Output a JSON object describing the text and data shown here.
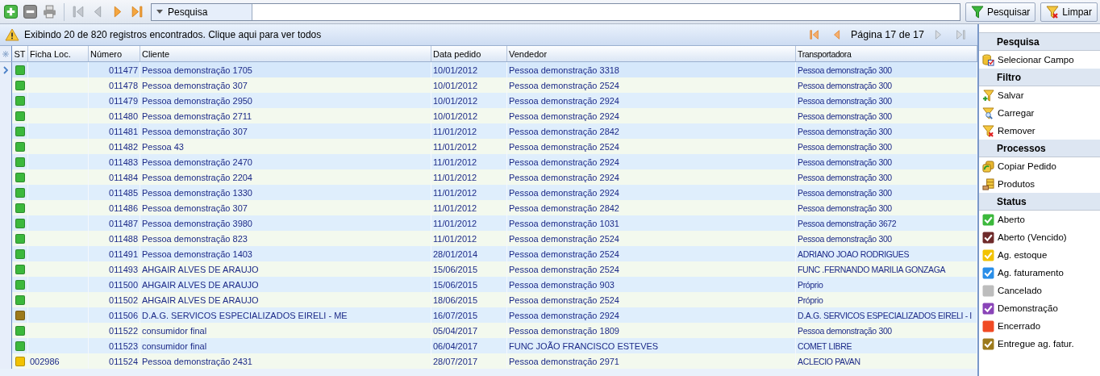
{
  "toolbar": {
    "nav": [
      {
        "kind": "first",
        "disabled": true
      },
      {
        "kind": "prev",
        "disabled": true
      },
      {
        "kind": "next",
        "disabled": false
      },
      {
        "kind": "last",
        "disabled": false
      }
    ],
    "search": {
      "field_selector": "Pesquisa"
    },
    "buttons": [
      {
        "kind": "search",
        "label": "Pesquisar"
      },
      {
        "kind": "clear",
        "label": "Limpar"
      }
    ]
  },
  "info_bar": {
    "message": "Exibindo 20 de 820 registros encontrados. Clique aqui para ver todos",
    "page_label": "Página 17 de 17",
    "nav": [
      {
        "kind": "first",
        "disabled": false
      },
      {
        "kind": "prev",
        "disabled": false
      },
      {
        "kind": "next",
        "disabled": true
      },
      {
        "kind": "last",
        "disabled": true
      }
    ]
  },
  "table": {
    "columns": [
      "ST",
      "Ficha Loc.",
      "Número",
      "Cliente",
      "Data pedido",
      "Vendedor",
      "Transportadora"
    ],
    "rows": [
      {
        "selected": true,
        "color": "#3cb83c",
        "ficha": "",
        "numero": "011477",
        "cliente": "Pessoa demonstração 1705",
        "data": "10/01/2012",
        "vendedor": "Pessoa demonstração 3318",
        "transportadora": "Pessoa demonstração 300"
      },
      {
        "selected": false,
        "color": "#3cb83c",
        "ficha": "",
        "numero": "011478",
        "cliente": "Pessoa demonstração 307",
        "data": "10/01/2012",
        "vendedor": "Pessoa demonstração 2524",
        "transportadora": "Pessoa demonstração 300"
      },
      {
        "selected": false,
        "color": "#3cb83c",
        "ficha": "",
        "numero": "011479",
        "cliente": "Pessoa demonstração 2950",
        "data": "10/01/2012",
        "vendedor": "Pessoa demonstração 2924",
        "transportadora": "Pessoa demonstração 300"
      },
      {
        "selected": false,
        "color": "#3cb83c",
        "ficha": "",
        "numero": "011480",
        "cliente": "Pessoa demonstração 2711",
        "data": "10/01/2012",
        "vendedor": "Pessoa demonstração 2924",
        "transportadora": "Pessoa demonstração 300"
      },
      {
        "selected": false,
        "color": "#3cb83c",
        "ficha": "",
        "numero": "011481",
        "cliente": "Pessoa demonstração 307",
        "data": "11/01/2012",
        "vendedor": "Pessoa demonstração 2842",
        "transportadora": "Pessoa demonstração 300"
      },
      {
        "selected": false,
        "color": "#3cb83c",
        "ficha": "",
        "numero": "011482",
        "cliente": "Pessoa 43",
        "data": "11/01/2012",
        "vendedor": "Pessoa demonstração 2524",
        "transportadora": "Pessoa demonstração 300"
      },
      {
        "selected": false,
        "color": "#3cb83c",
        "ficha": "",
        "numero": "011483",
        "cliente": "Pessoa demonstração 2470",
        "data": "11/01/2012",
        "vendedor": "Pessoa demonstração 2924",
        "transportadora": "Pessoa demonstração 300"
      },
      {
        "selected": false,
        "color": "#3cb83c",
        "ficha": "",
        "numero": "011484",
        "cliente": "Pessoa demonstração 2204",
        "data": "11/01/2012",
        "vendedor": "Pessoa demonstração 2924",
        "transportadora": "Pessoa demonstração 300"
      },
      {
        "selected": false,
        "color": "#3cb83c",
        "ficha": "",
        "numero": "011485",
        "cliente": "Pessoa demonstração 1330",
        "data": "11/01/2012",
        "vendedor": "Pessoa demonstração 2924",
        "transportadora": "Pessoa demonstração 300"
      },
      {
        "selected": false,
        "color": "#3cb83c",
        "ficha": "",
        "numero": "011486",
        "cliente": "Pessoa demonstração 307",
        "data": "11/01/2012",
        "vendedor": "Pessoa demonstração 2842",
        "transportadora": "Pessoa demonstração 300"
      },
      {
        "selected": false,
        "color": "#3cb83c",
        "ficha": "",
        "numero": "011487",
        "cliente": "Pessoa demonstração 3980",
        "data": "11/01/2012",
        "vendedor": "Pessoa demonstração 1031",
        "transportadora": "Pessoa demonstração 3672"
      },
      {
        "selected": false,
        "color": "#3cb83c",
        "ficha": "",
        "numero": "011488",
        "cliente": "Pessoa demonstração 823",
        "data": "11/01/2012",
        "vendedor": "Pessoa demonstração 2524",
        "transportadora": "Pessoa demonstração 300"
      },
      {
        "selected": false,
        "color": "#3cb83c",
        "ficha": "",
        "numero": "011491",
        "cliente": "Pessoa demonstração 1403",
        "data": "28/01/2014",
        "vendedor": "Pessoa demonstração 2524",
        "transportadora": "ADRIANO JOAO RODRIGUES"
      },
      {
        "selected": false,
        "color": "#3cb83c",
        "ficha": "",
        "numero": "011493",
        "cliente": "AHGAIR ALVES DE ARAUJO",
        "data": "15/06/2015",
        "vendedor": "Pessoa demonstração 2524",
        "transportadora": "FUNC .FERNANDO MARILIA GONZAGA"
      },
      {
        "selected": false,
        "color": "#3cb83c",
        "ficha": "",
        "numero": "011500",
        "cliente": "AHGAIR ALVES DE ARAUJO",
        "data": "15/06/2015",
        "vendedor": "Pessoa demonstração 903",
        "transportadora": "Próprio"
      },
      {
        "selected": false,
        "color": "#3cb83c",
        "ficha": "",
        "numero": "011502",
        "cliente": "AHGAIR ALVES DE ARAUJO",
        "data": "18/06/2015",
        "vendedor": "Pessoa demonstração 2524",
        "transportadora": "Próprio"
      },
      {
        "selected": false,
        "color": "#9c7a1c",
        "ficha": "",
        "numero": "011506",
        "cliente": "D.A.G. SERVICOS ESPECIALIZADOS EIRELI  - ME",
        "data": "16/07/2015",
        "vendedor": "Pessoa demonstração 2924",
        "transportadora": "D.A.G. SERVICOS ESPECIALIZADOS EIRELI  - I"
      },
      {
        "selected": false,
        "color": "#3cb83c",
        "ficha": "",
        "numero": "011522",
        "cliente": "consumidor final",
        "data": "05/04/2017",
        "vendedor": "Pessoa demonstração 1809",
        "transportadora": "Pessoa demonstração 300"
      },
      {
        "selected": false,
        "color": "#3cb83c",
        "ficha": "",
        "numero": "011523",
        "cliente": "consumidor final",
        "data": "06/04/2017",
        "vendedor": "FUNC JOÃO FRANCISCO ESTEVES",
        "transportadora": "COMET LIBRE"
      },
      {
        "selected": false,
        "color": "#f2c200",
        "ficha": "002986",
        "numero": "011524",
        "cliente": "Pessoa demonstração 2431",
        "data": "28/07/2017",
        "vendedor": "Pessoa demonstração 2971",
        "transportadora": "ACLECIO PAVAN"
      }
    ]
  },
  "side_panel": {
    "sections": [
      {
        "title": "Pesquisa",
        "items": [
          {
            "kind": "field",
            "label": "Selecionar Campo"
          }
        ]
      },
      {
        "title": "Filtro",
        "items": [
          {
            "kind": "save",
            "label": "Salvar"
          },
          {
            "kind": "load",
            "label": "Carregar"
          },
          {
            "kind": "remove",
            "label": "Remover"
          }
        ]
      },
      {
        "title": "Processos",
        "items": [
          {
            "kind": "copy",
            "label": "Copiar Pedido"
          },
          {
            "kind": "products",
            "label": "Produtos"
          }
        ]
      },
      {
        "title": "Status",
        "items": [
          {
            "kind": "status",
            "label": "Aberto",
            "color": "#3cb83c",
            "checked": true
          },
          {
            "kind": "status",
            "label": "Aberto (Vencido)",
            "color": "#6e2a2a",
            "checked": true
          },
          {
            "kind": "status",
            "label": "Ag. estoque",
            "color": "#f2c200",
            "checked": true
          },
          {
            "kind": "status",
            "label": "Ag. faturamento",
            "color": "#2a8ee8",
            "checked": true
          },
          {
            "kind": "status",
            "label": "Cancelado",
            "color": "#bdbdbd",
            "checked": false
          },
          {
            "kind": "status",
            "label": "Demonstração",
            "color": "#8a44b8",
            "checked": true
          },
          {
            "kind": "status",
            "label": "Encerrado",
            "color": "#f04a24",
            "checked": false
          },
          {
            "kind": "status",
            "label": "Entregue ag. fatur.",
            "color": "#9c7a1c",
            "checked": true
          }
        ]
      }
    ]
  }
}
